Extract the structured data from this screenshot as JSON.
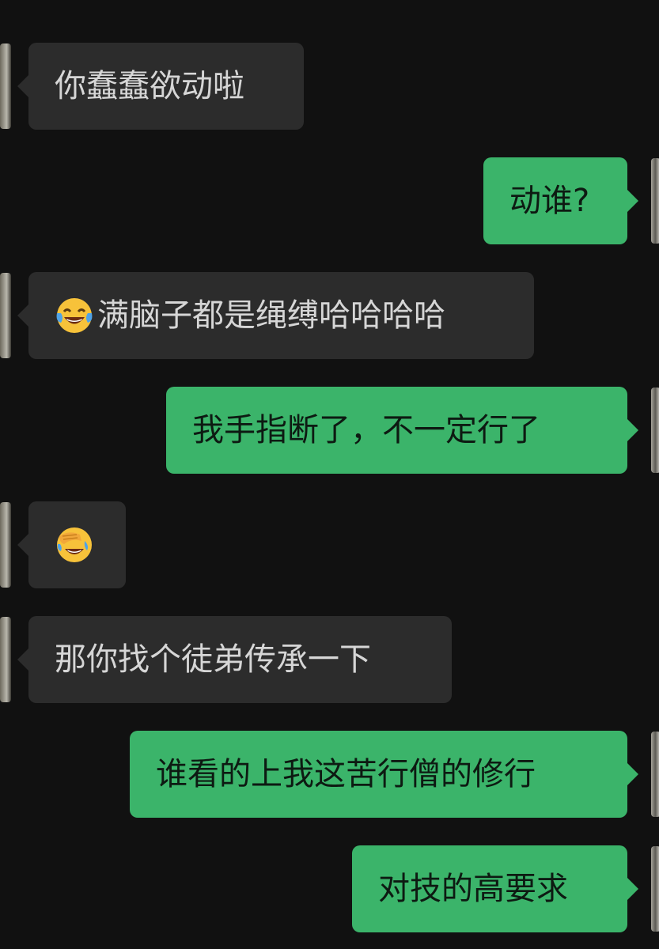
{
  "colors": {
    "background": "#111111",
    "incoming_bubble": "#2c2c2c",
    "outgoing_bubble": "#3bb46a",
    "incoming_text": "#d6d6d6",
    "outgoing_text": "#0d1a12"
  },
  "messages": [
    {
      "side": "in",
      "text": "你蠢蠢欲动啦"
    },
    {
      "side": "out",
      "text": "动谁?"
    },
    {
      "side": "in",
      "emoji": "face-with-tears-of-joy-icon",
      "text": "满脑子都是绳缚哈哈哈哈"
    },
    {
      "side": "out",
      "text": "我手指断了，不一定行了"
    },
    {
      "side": "in",
      "emoji": "face-palm-icon",
      "text": ""
    },
    {
      "side": "in",
      "text": "那你找个徒弟传承一下"
    },
    {
      "side": "out",
      "text": "谁看的上我这苦行僧的修行"
    },
    {
      "side": "out",
      "text": "对技的高要求"
    }
  ]
}
